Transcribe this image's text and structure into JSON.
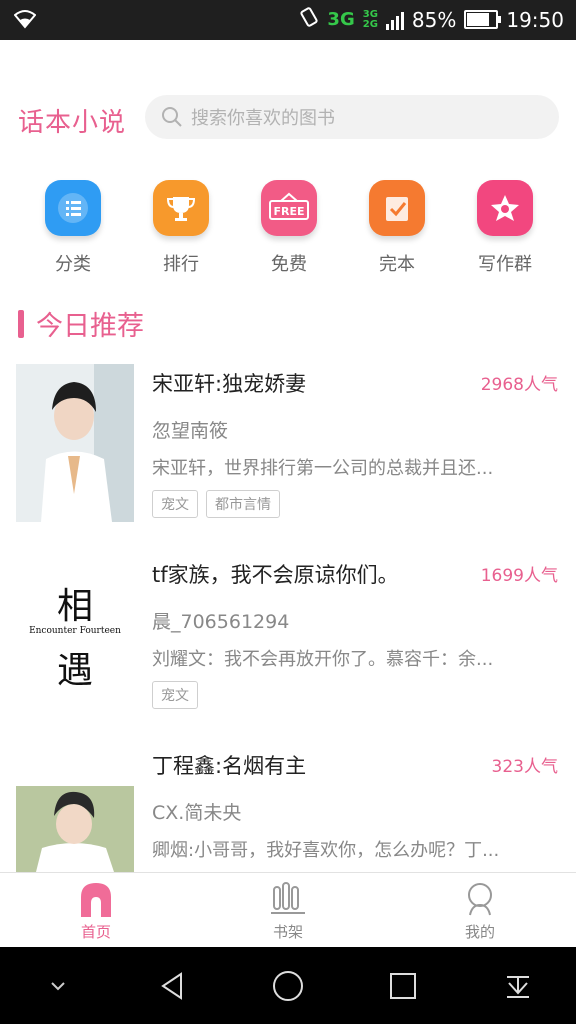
{
  "status_bar": {
    "network": "3G",
    "network_small_top": "3G",
    "network_small_bottom": "2G",
    "battery": "85%",
    "battery_level": 0.85,
    "time": "19:50"
  },
  "header": {
    "app_name": "话本小说",
    "search_placeholder": "搜索你喜欢的图书"
  },
  "categories": [
    {
      "label": "分类",
      "icon": "list-icon",
      "color": "#2f9cf3"
    },
    {
      "label": "排行",
      "icon": "trophy-icon",
      "color": "#f7992c"
    },
    {
      "label": "免费",
      "icon": "free-icon",
      "color": "#f25b86",
      "badge": "FREE"
    },
    {
      "label": "完本",
      "icon": "check-note-icon",
      "color": "#f57a30"
    },
    {
      "label": "写作群",
      "icon": "star-icon",
      "color": "#f2477f"
    }
  ],
  "section": {
    "title": "今日推荐"
  },
  "cover_text": {
    "top_char": "相",
    "subtitle": "Encounter Fourteen",
    "bottom_char": "遇"
  },
  "books": [
    {
      "title": "宋亚轩:独宠娇妻",
      "popularity": "2968人气",
      "author": "忽望南筱",
      "desc": "宋亚轩，世界排行第一公司的总裁并且还...",
      "tags": [
        "宠文",
        "都市言情"
      ]
    },
    {
      "title": "tf家族，我不会原谅你们。",
      "popularity": "1699人气",
      "author": "晨_706561294",
      "desc": "刘耀文：我不会再放开你了。慕容千：余...",
      "tags": [
        "宠文"
      ]
    },
    {
      "title": "丁程鑫:名烟有主",
      "popularity": "323人气",
      "author": "CX.简未央",
      "desc": "卿烟:小哥哥，我好喜欢你，怎么办呢？丁...",
      "tags": []
    }
  ],
  "tabs": [
    {
      "label": "首页",
      "icon": "home-icon",
      "active": true
    },
    {
      "label": "书架",
      "icon": "bookshelf-icon",
      "active": false
    },
    {
      "label": "我的",
      "icon": "profile-icon",
      "active": false
    }
  ],
  "colors": {
    "accent": "#e8608f"
  }
}
